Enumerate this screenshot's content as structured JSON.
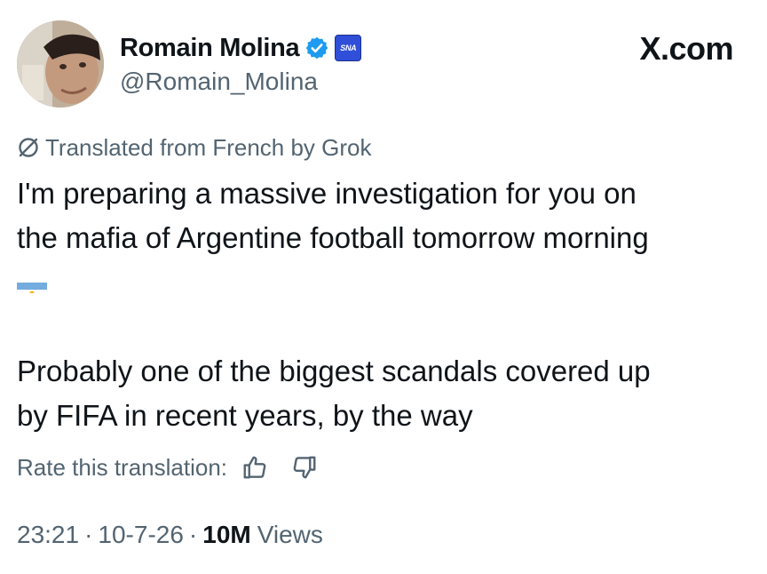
{
  "author": {
    "display_name": "Romain Molina",
    "handle": "@Romain_Molina",
    "verified_badge_icon": "verified-check-icon",
    "affiliate_badge_text": "SNA",
    "affiliate_badge_color": "#2f4fd8"
  },
  "brand": {
    "label": "X.com"
  },
  "translation": {
    "notice_icon": "grok-icon",
    "notice_text": "Translated from French by Grok",
    "rate_label": "Rate this translation:",
    "thumbs_up_icon": "thumbs-up-icon",
    "thumbs_down_icon": "thumbs-down-icon"
  },
  "tweet": {
    "lines": [
      "I'm preparing a massive investigation for you on",
      "the mafia of Argentine football tomorrow morning",
      "Probably one of the biggest scandals covered up",
      "by FIFA in recent years, by the way"
    ],
    "flag_emoji": "🇦🇷",
    "flag_icon": "argentina-flag-icon"
  },
  "meta": {
    "time": "23:21",
    "date": "10-7-26",
    "views_count": "10M",
    "views_label": "Views",
    "separator": "·"
  },
  "colors": {
    "text_primary": "#0f1419",
    "text_secondary": "#536471",
    "verified_blue": "#1d9bf0"
  }
}
